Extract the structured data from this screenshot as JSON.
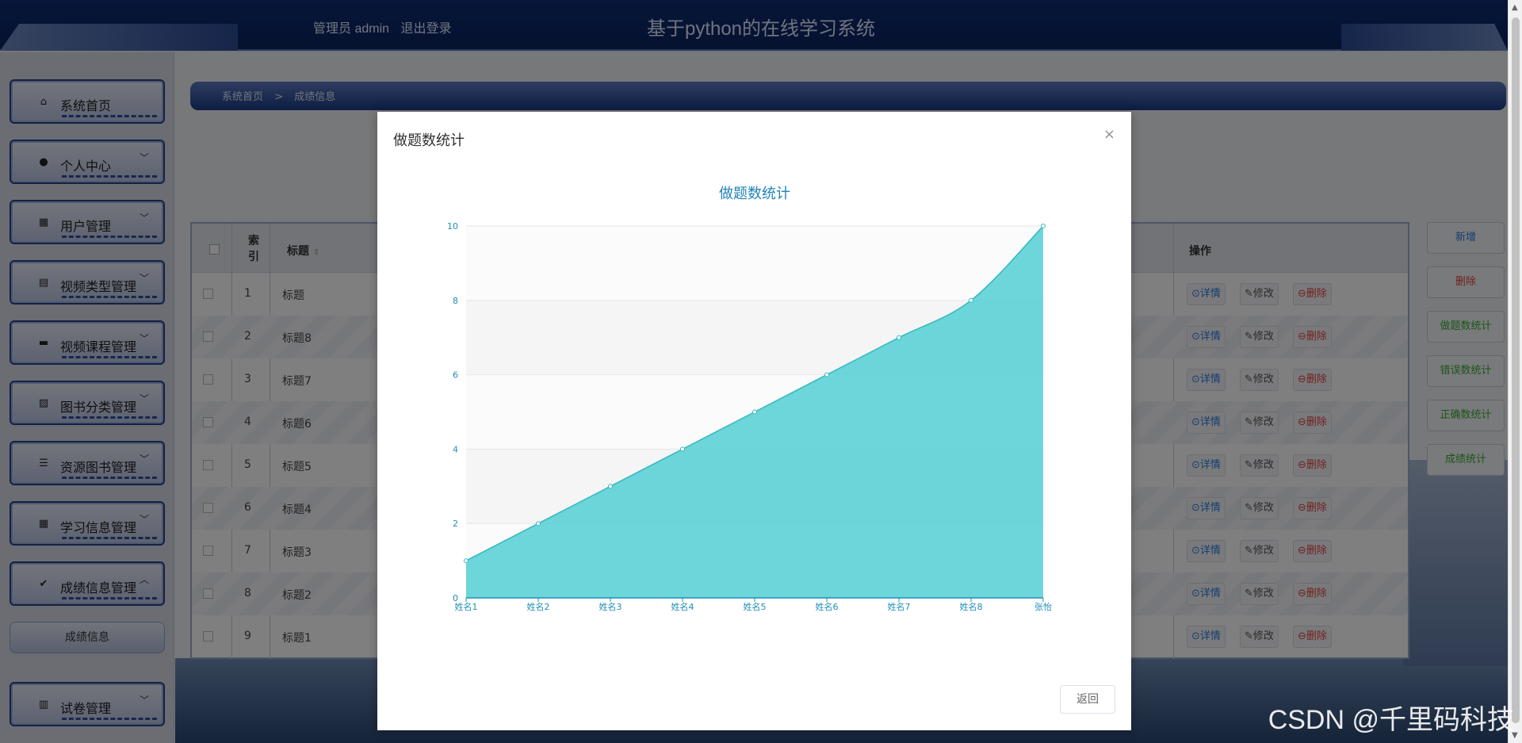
{
  "header": {
    "user_role": "管理员 admin",
    "logout": "退出登录",
    "system_title": "基于python的在线学习系统"
  },
  "sidebar": {
    "items": [
      {
        "label": "系统首页",
        "icon": "home-icon",
        "has_arrow": false
      },
      {
        "label": "个人中心",
        "icon": "user-icon",
        "has_arrow": true
      },
      {
        "label": "用户管理",
        "icon": "grid-icon",
        "has_arrow": true
      },
      {
        "label": "视频类型管理",
        "icon": "clipboard-icon",
        "has_arrow": true
      },
      {
        "label": "视频课程管理",
        "icon": "monitor-icon",
        "has_arrow": true
      },
      {
        "label": "图书分类管理",
        "icon": "chart-icon",
        "has_arrow": true
      },
      {
        "label": "资源图书管理",
        "icon": "list-icon",
        "has_arrow": true
      },
      {
        "label": "学习信息管理",
        "icon": "grid-icon",
        "has_arrow": true
      },
      {
        "label": "成绩信息管理",
        "icon": "check-clipboard-icon",
        "has_arrow": true,
        "expanded": true
      },
      {
        "label": "试卷管理",
        "icon": "bar-chart-icon",
        "has_arrow": true
      }
    ],
    "submenu": {
      "label": "成绩信息"
    }
  },
  "breadcrumb": {
    "home": "系统首页",
    "separator": ">",
    "current": "成绩信息"
  },
  "table": {
    "headers": {
      "index": "索引",
      "title": "标题",
      "ops": "操作"
    },
    "rows": [
      {
        "index": "1",
        "title": "标题"
      },
      {
        "index": "2",
        "title": "标题8"
      },
      {
        "index": "3",
        "title": "标题7"
      },
      {
        "index": "4",
        "title": "标题6"
      },
      {
        "index": "5",
        "title": "标题5"
      },
      {
        "index": "6",
        "title": "标题4"
      },
      {
        "index": "7",
        "title": "标题3"
      },
      {
        "index": "8",
        "title": "标题2"
      },
      {
        "index": "9",
        "title": "标题1"
      }
    ],
    "actions": {
      "detail": "⊙详情",
      "edit": "✎修改",
      "delete": "⊖删除"
    }
  },
  "side_buttons": [
    {
      "label": "新增",
      "color": "#2a7ae2"
    },
    {
      "label": "删除",
      "color": "#e04242"
    },
    {
      "label": "做题数统计",
      "color": "#3aaa35"
    },
    {
      "label": "错误数统计",
      "color": "#3aaa35"
    },
    {
      "label": "正确数统计",
      "color": "#3aaa35"
    },
    {
      "label": "成绩统计",
      "color": "#3aaa35"
    }
  ],
  "dialog": {
    "title": "做题数统计",
    "close_label": "×",
    "back_button": "返回"
  },
  "chart_data": {
    "type": "area",
    "title": "做题数统计",
    "categories": [
      "姓名1",
      "姓名2",
      "姓名3",
      "姓名4",
      "姓名5",
      "姓名6",
      "姓名7",
      "姓名8",
      "张怡"
    ],
    "values": [
      1,
      2,
      3,
      4,
      5,
      6,
      7,
      8,
      10
    ],
    "ylim": [
      0,
      10
    ],
    "yticks": [
      0,
      2,
      4,
      6,
      8,
      10
    ],
    "smooth": true,
    "colors": {
      "fill": "#5cd1d6",
      "line": "#35b8c2",
      "axis": "#1f8fb5",
      "title": "#2184b8"
    }
  },
  "watermark": "CSDN @千里码科技"
}
